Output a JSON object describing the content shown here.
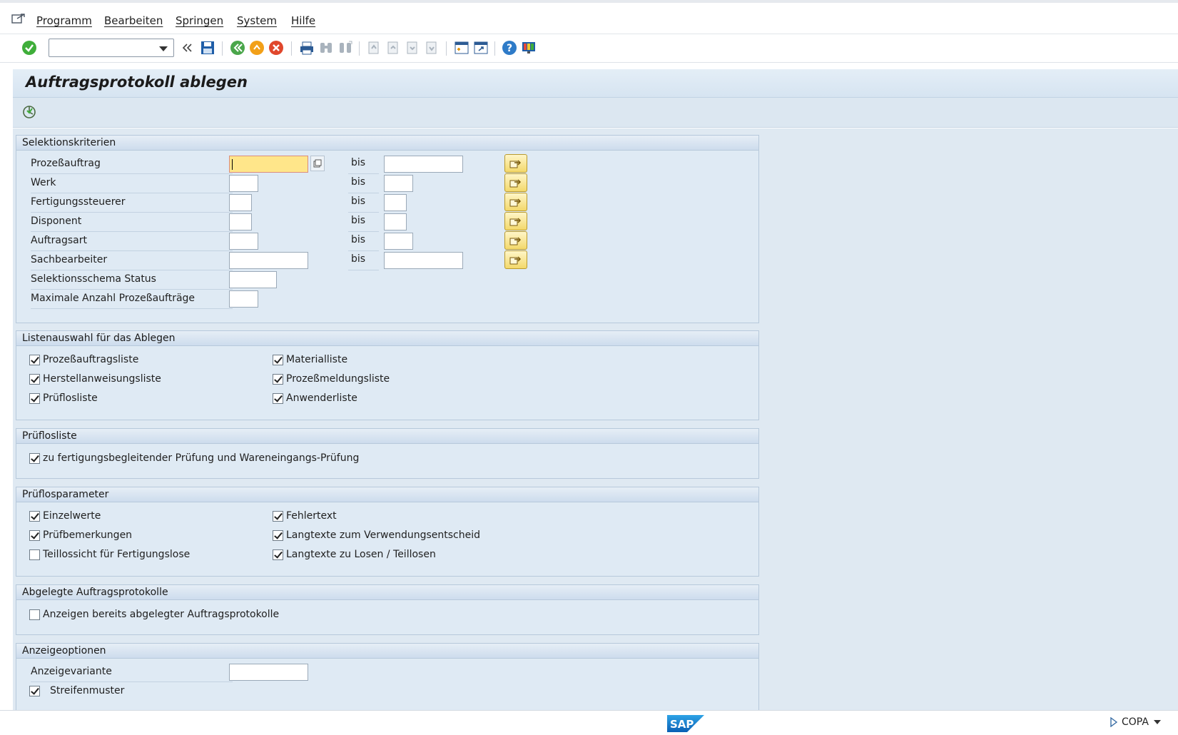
{
  "menu": {
    "items": [
      "Programm",
      "Bearbeiten",
      "Springen",
      "System",
      "Hilfe"
    ]
  },
  "toolbar": {
    "command_value": "",
    "icons": [
      "enter-check-icon",
      "command-field",
      "back-double-arrow-icon",
      "save-icon",
      "back-icon",
      "exit-icon",
      "cancel-icon",
      "print-icon",
      "find-icon",
      "find-next-icon",
      "first-page-icon",
      "previous-page-icon",
      "next-page-icon",
      "last-page-icon",
      "create-session-icon",
      "shortcut-icon",
      "help-icon",
      "customize-layout-icon"
    ]
  },
  "title": "Auftragsprotokoll ablegen",
  "groups": {
    "selection": {
      "header": "Selektionskriterien",
      "bis_label": "bis",
      "rows": [
        {
          "label": "Prozeßauftrag",
          "from": "",
          "to": ""
        },
        {
          "label": "Werk",
          "from": "",
          "to": ""
        },
        {
          "label": "Fertigungssteuerer",
          "from": "",
          "to": ""
        },
        {
          "label": "Disponent",
          "from": "",
          "to": ""
        },
        {
          "label": "Auftragsart",
          "from": "",
          "to": ""
        },
        {
          "label": "Sachbearbeiter",
          "from": "",
          "to": ""
        },
        {
          "label": "Selektionsschema Status",
          "value": ""
        },
        {
          "label": "Maximale Anzahl Prozeßaufträge",
          "value": ""
        }
      ]
    },
    "lists": {
      "header": "Listenauswahl für das Ablegen",
      "items": [
        {
          "label": "Prozeßauftragsliste",
          "checked": true
        },
        {
          "label": "Materialliste",
          "checked": true
        },
        {
          "label": "Herstellanweisungsliste",
          "checked": true
        },
        {
          "label": "Prozeßmeldungsliste",
          "checked": true
        },
        {
          "label": "Prüflosliste",
          "checked": true
        },
        {
          "label": "Anwenderliste",
          "checked": true
        }
      ]
    },
    "inspection_list": {
      "header": "Prüflosliste",
      "items": [
        {
          "label": "zu fertigungsbegleitender Prüfung und Wareneingangs-Prüfung",
          "checked": true
        }
      ]
    },
    "inspection_params": {
      "header": "Prüflosparameter",
      "items": [
        {
          "label": "Einzelwerte",
          "checked": true
        },
        {
          "label": "Fehlertext",
          "checked": true
        },
        {
          "label": "Prüfbemerkungen",
          "checked": true
        },
        {
          "label": "Langtexte zum Verwendungsentscheid",
          "checked": true
        },
        {
          "label": "Teillossicht für Fertigungslose",
          "checked": false
        },
        {
          "label": "Langtexte zu Losen / Teillosen",
          "checked": true
        }
      ]
    },
    "archived": {
      "header": "Abgelegte Auftragsprotokolle",
      "items": [
        {
          "label": "Anzeigen bereits abgelegter Auftragsprotokolle",
          "checked": false
        }
      ]
    },
    "display": {
      "header": "Anzeigeoptionen",
      "variant_label": "Anzeigevariante",
      "variant_value": "",
      "items": [
        {
          "label": "Streifenmuster",
          "checked": true
        }
      ]
    }
  },
  "status": {
    "logo": "SAP",
    "system": "COPA"
  }
}
